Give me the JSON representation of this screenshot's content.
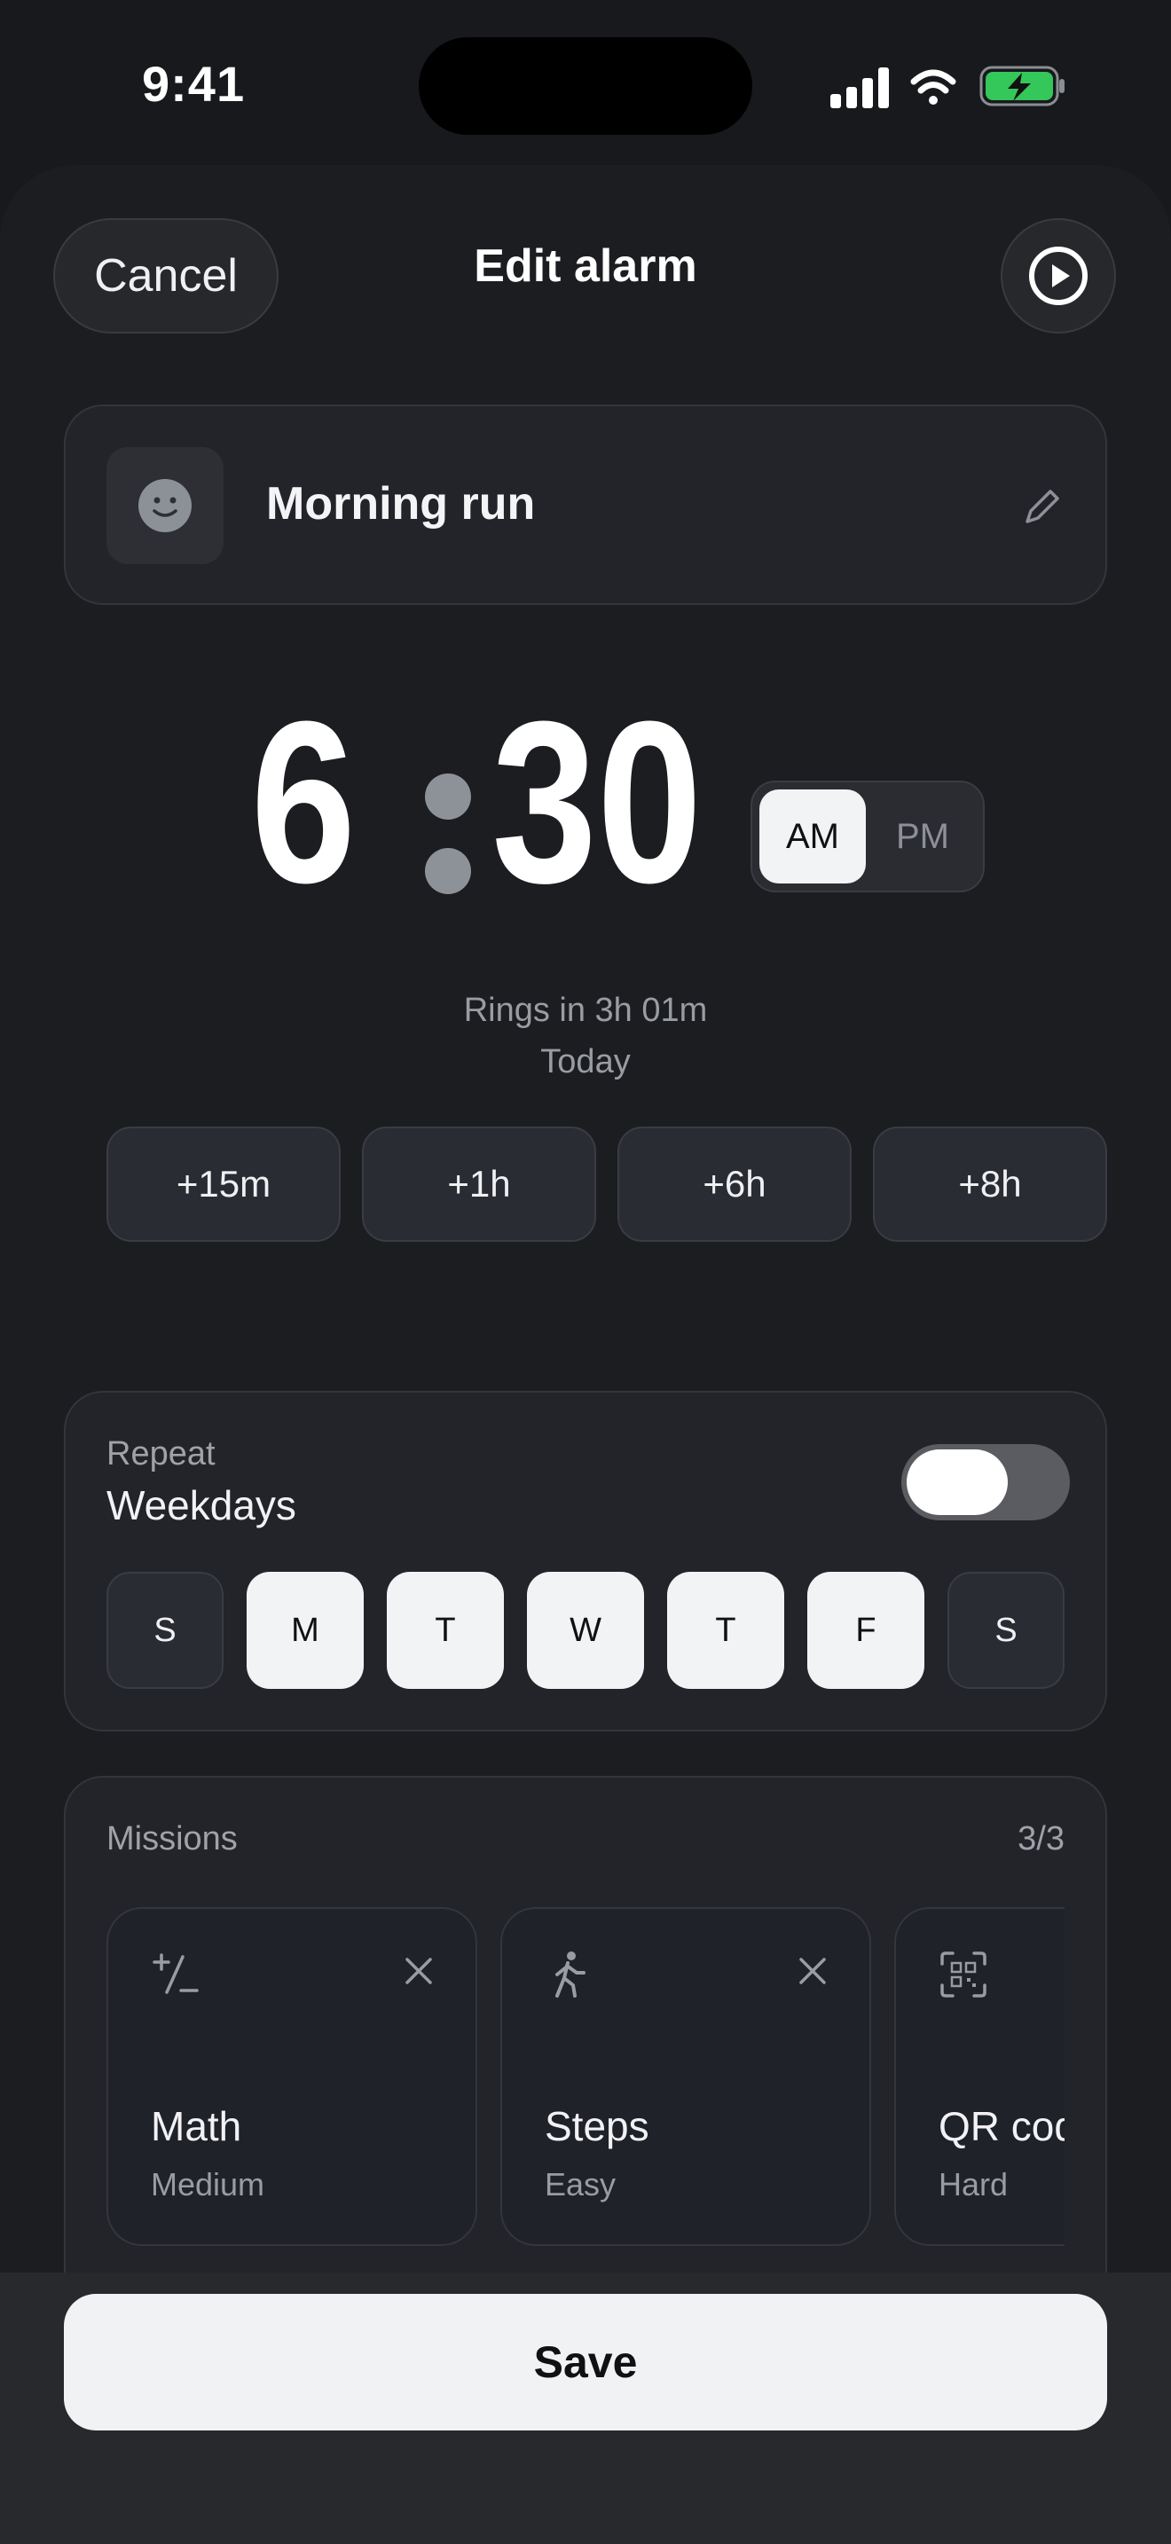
{
  "status_bar": {
    "time": "9:41"
  },
  "header": {
    "cancel_label": "Cancel",
    "title": "Edit alarm"
  },
  "alarm_name": {
    "label": "Morning run",
    "emoji_icon": "smiley-face-icon"
  },
  "time_display": {
    "hour": "6",
    "minute": "30",
    "am_label": "AM",
    "pm_label": "PM",
    "selected": "AM"
  },
  "rings_info": {
    "line1": "Rings in 3h 01m",
    "line2": "Today"
  },
  "quick_add": [
    "+15m",
    "+1h",
    "+6h",
    "+8h"
  ],
  "repeat": {
    "label": "Repeat",
    "value": "Weekdays",
    "enabled": true,
    "days": [
      {
        "letter": "S",
        "active": false
      },
      {
        "letter": "M",
        "active": true
      },
      {
        "letter": "T",
        "active": true
      },
      {
        "letter": "W",
        "active": true
      },
      {
        "letter": "T",
        "active": true
      },
      {
        "letter": "F",
        "active": true
      },
      {
        "letter": "S",
        "active": false
      }
    ]
  },
  "missions": {
    "label": "Missions",
    "count": "3/3",
    "items": [
      {
        "icon": "plus-minus-icon",
        "title": "Math",
        "difficulty": "Medium"
      },
      {
        "icon": "walking-person-icon",
        "title": "Steps",
        "difficulty": "Easy"
      },
      {
        "icon": "qr-code-icon",
        "title": "QR code",
        "difficulty": "Hard"
      }
    ]
  },
  "save_label": "Save",
  "colors": {
    "background": "#18191c",
    "card": "#22242a",
    "active_day": "#f2f3f5",
    "battery": "#34c759"
  }
}
